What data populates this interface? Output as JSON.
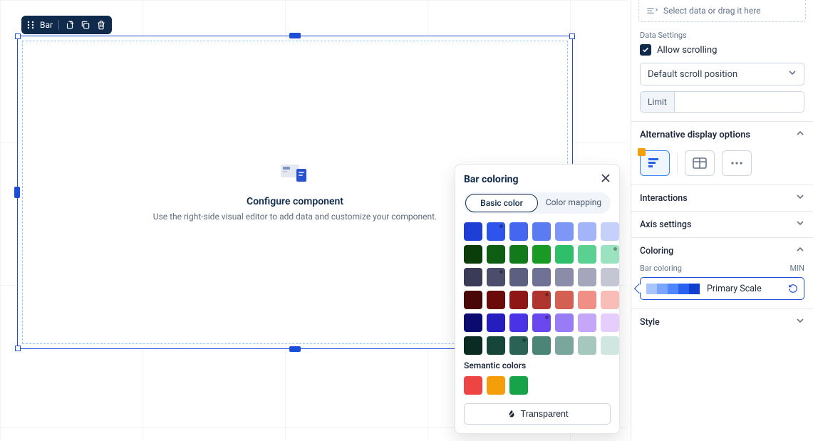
{
  "toolbar": {
    "label": "Bar"
  },
  "empty_state": {
    "title": "Configure component",
    "subtitle": "Use the right-side visual editor to add data and customize your component."
  },
  "panel": {
    "sorting_hint": "Select data or drag it here",
    "data_settings_label": "Data Settings",
    "allow_scrolling_label": "Allow scrolling",
    "scroll_position_value": "Default scroll position",
    "limit_label": "Limit",
    "alt_display_label": "Alternative display options",
    "interactions_label": "Interactions",
    "axis_settings_label": "Axis settings",
    "coloring_label": "Coloring",
    "bar_coloring_label": "Bar coloring",
    "bar_coloring_agg": "MIN",
    "scale_name": "Primary Scale",
    "scale_colors": [
      "#a8c4ff",
      "#7ba4ff",
      "#4f85ff",
      "#2a62f0",
      "#0f3fd1"
    ],
    "style_label": "Style"
  },
  "popover": {
    "title": "Bar coloring",
    "tab_basic": "Basic color",
    "tab_mapping": "Color mapping",
    "palette": [
      [
        "#1d3fd6",
        "#2f54eb",
        "#4466f0",
        "#5a7bf2",
        "#7e97f6",
        "#a3b4f9",
        "#c6d1fb"
      ],
      [
        "#0a3d0a",
        "#0d5d12",
        "#127a1a",
        "#189a24",
        "#2fbf6a",
        "#5bd191",
        "#9be3c0"
      ],
      [
        "#3a3b56",
        "#4b4d6b",
        "#5d5f80",
        "#707295",
        "#8a8ca8",
        "#a5a6bc",
        "#c5c6d4"
      ],
      [
        "#4a0707",
        "#6b0a0a",
        "#8f1616",
        "#b0352e",
        "#d46054",
        "#ef8f85",
        "#f7bdb6"
      ],
      [
        "#0b0a6e",
        "#261dbf",
        "#4a33e6",
        "#6b47f0",
        "#9a7bf6",
        "#c5a6f9",
        "#e6cefc"
      ],
      [
        "#0a2b22",
        "#16463a",
        "#2a6356",
        "#4d8478",
        "#7aa69b",
        "#a5c7be",
        "#d2e6e1"
      ]
    ],
    "palette_dots": [
      "0,1",
      "1,6",
      "2,1",
      "3,3",
      "4,3",
      "5,2"
    ],
    "semantic_label": "Semantic colors",
    "semantic": [
      "#ef4444",
      "#f59e0b",
      "#16a34a"
    ],
    "transparent_label": "Transparent"
  }
}
